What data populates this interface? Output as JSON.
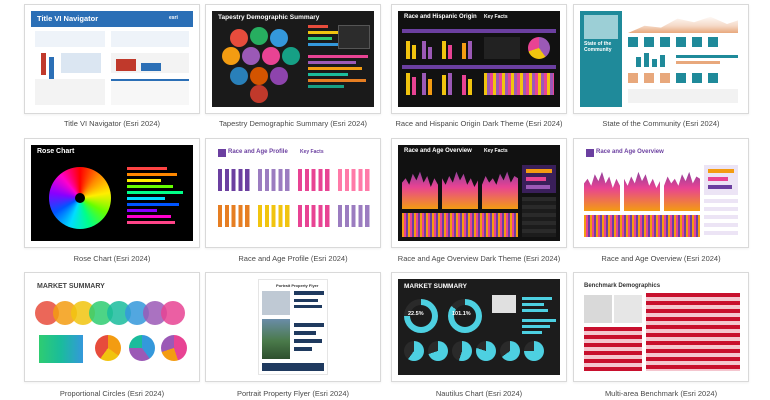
{
  "cards": [
    {
      "caption": "Title VI Navigator (Esri 2024)",
      "thumb_title": "Title VI Navigator",
      "thumb_brand": "esri"
    },
    {
      "caption": "Tapestry Demographic Summary (Esri 2024)",
      "thumb_title": "Tapestry Demographic Summary"
    },
    {
      "caption": "Race and Hispanic Origin Dark Theme (Esri 2024)",
      "thumb_title": "Race and Hispanic Origin",
      "thumb_sub": "Key Facts"
    },
    {
      "caption": "State of the Community (Esri 2024)",
      "thumb_title": "State of the Community"
    },
    {
      "caption": "Rose Chart (Esri 2024)",
      "thumb_title": "Rose Chart"
    },
    {
      "caption": "Race and Age Profile (Esri 2024)",
      "thumb_title": "Race and Age Profile",
      "thumb_sub": "Key Facts"
    },
    {
      "caption": "Race and Age Overview Dark Theme (Esri 2024)",
      "thumb_title": "Race and Age Overview",
      "thumb_sub": "Key Facts"
    },
    {
      "caption": "Race and Age Overview (Esri 2024)",
      "thumb_title": "Race and Age Overview"
    },
    {
      "caption": "Proportional Circles (Esri 2024)",
      "thumb_title": "MARKET SUMMARY"
    },
    {
      "caption": "Portrait Property Flyer (Esri 2024)",
      "thumb_title": "Portrait Property Flyer"
    },
    {
      "caption": "Nautilus Chart (Esri 2024)",
      "thumb_title": "MARKET SUMMARY",
      "thumb_stat1": "22.5%",
      "thumb_stat2": "101.1%"
    },
    {
      "caption": "Multi-area Benchmark (Esri 2024)",
      "thumb_title": "Benchmark Demographics"
    }
  ],
  "colors": {
    "esri_blue": "#2b6fb6",
    "dark_bg": "#111111",
    "purple": "#6b3fa0",
    "teal": "#1f8a9a",
    "benchmark_red": "#c8102e"
  }
}
